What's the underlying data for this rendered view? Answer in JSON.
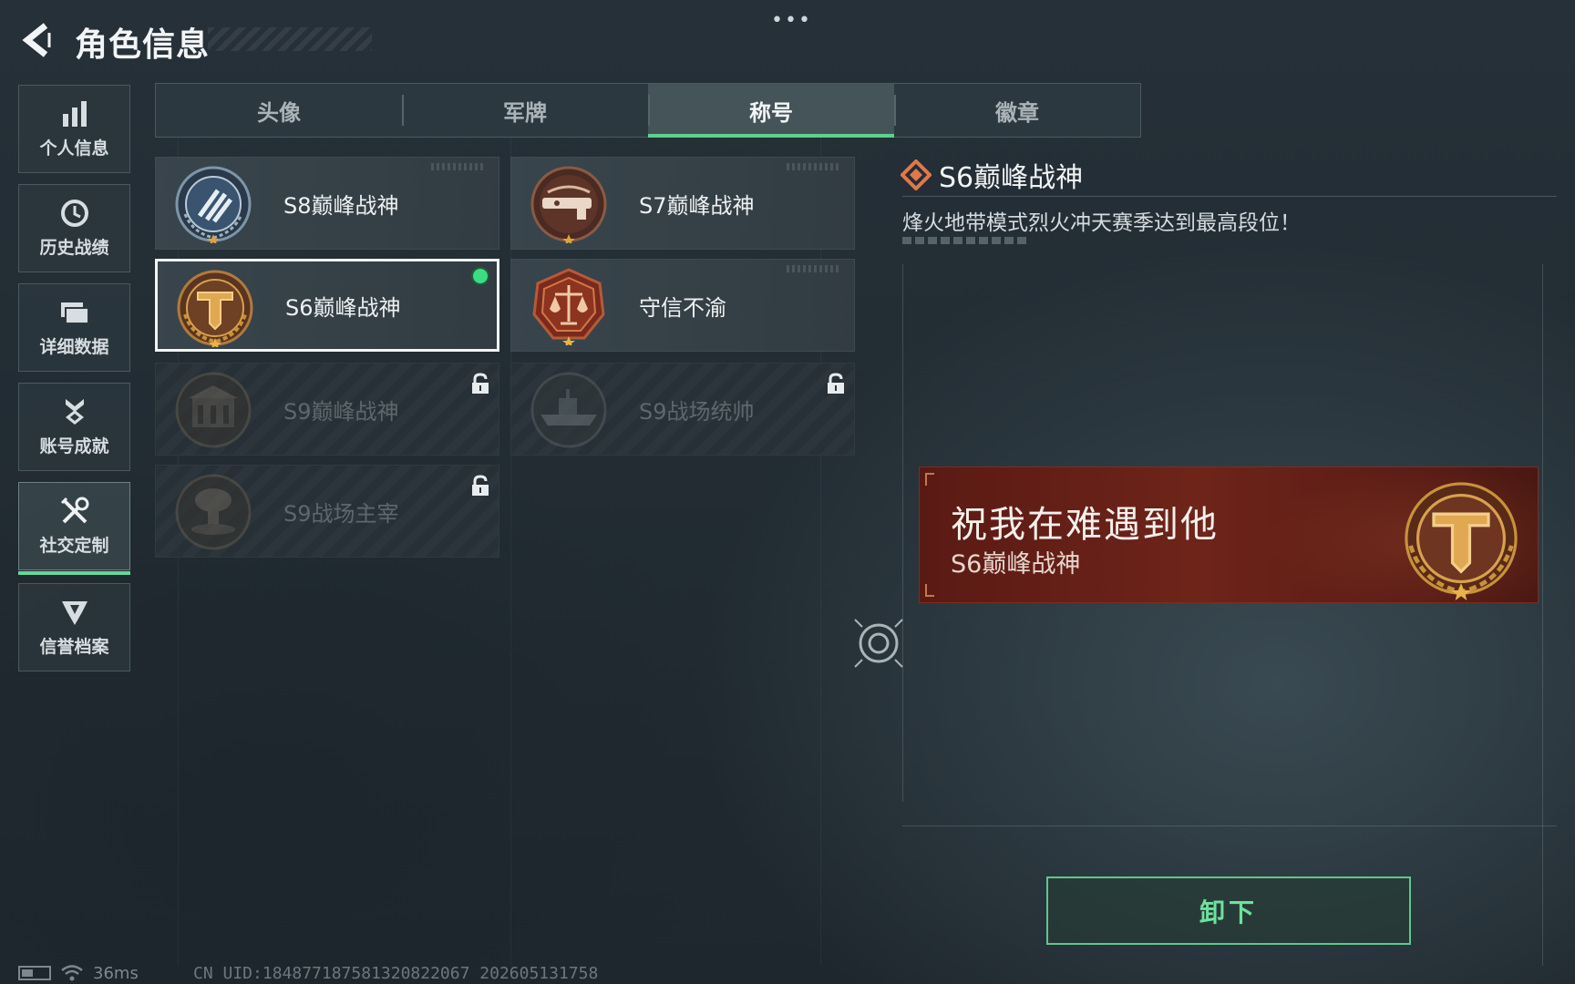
{
  "header": {
    "title": "角色信息",
    "dots": "•••"
  },
  "sidebar": {
    "items": [
      {
        "label": "个人信息",
        "icon": "bar-chart-icon"
      },
      {
        "label": "历史战绩",
        "icon": "clock-icon"
      },
      {
        "label": "详细数据",
        "icon": "folder-icon"
      },
      {
        "label": "账号成就",
        "icon": "medal-icon"
      },
      {
        "label": "社交定制",
        "icon": "tools-icon",
        "active": true
      },
      {
        "label": "信誉档案",
        "icon": "shield-icon"
      }
    ]
  },
  "tabs": [
    {
      "label": "头像"
    },
    {
      "label": "军牌"
    },
    {
      "label": "称号",
      "active": true
    },
    {
      "label": "徽章"
    }
  ],
  "titles": [
    {
      "name": "S8巅峰战神",
      "locked": false,
      "selected": false
    },
    {
      "name": "S7巅峰战神",
      "locked": false,
      "selected": false
    },
    {
      "name": "S6巅峰战神",
      "locked": false,
      "selected": true,
      "equipped": true
    },
    {
      "name": "守信不渝",
      "locked": false,
      "selected": false
    },
    {
      "name": "S9巅峰战神",
      "locked": true,
      "selected": false
    },
    {
      "name": "S9战场统帅",
      "locked": true,
      "selected": false
    },
    {
      "name": "S9战场主宰",
      "locked": true,
      "selected": false
    }
  ],
  "detail": {
    "title": "S6巅峰战神",
    "description": "烽火地带模式烈火冲天赛季达到最高段位！",
    "banner_main": "祝我在难遇到他",
    "banner_sub": "S6巅峰战神",
    "action_label": "卸下"
  },
  "status_bar": {
    "ping": "36ms",
    "uid": "CN UID:184877187581320822067 202605131758"
  },
  "colors": {
    "accent": "#5fd08f",
    "equipped_dot": "#3ddc84",
    "banner_red": "#6e2419",
    "gold": "#c8923a"
  }
}
